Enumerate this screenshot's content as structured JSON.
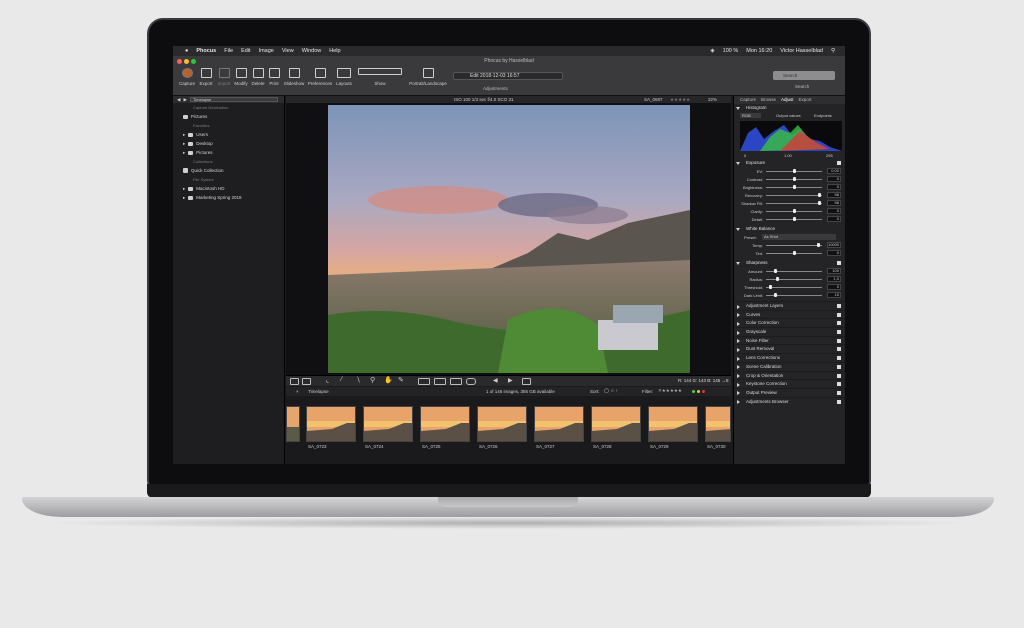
{
  "menubar": {
    "app": "Phocus",
    "items": [
      "File",
      "Edit",
      "Image",
      "View",
      "Window",
      "Help"
    ],
    "battery": "100 %",
    "clock": "Mon 16:20",
    "user": "Victor Hasselblad"
  },
  "window": {
    "title": "Phocus by Hasselblad",
    "edit_value": "Edit 2018-12-03 16:57",
    "adjustments_label": "Adjustments",
    "search_placeholder": "Search",
    "search_label": "Search",
    "show_label": "Show",
    "orientation_label": "Portrait/Landscape"
  },
  "toolbar": [
    "Capture",
    "Export",
    "Import",
    "Modify",
    "Delete",
    "Print",
    "Slideshow",
    "Preferences",
    "Layouts"
  ],
  "left_panel": {
    "dropdown": "Timelapse",
    "capture_destination": "Capture Destination",
    "pictures": "Pictures",
    "favorites": "Favorites",
    "users": "Users",
    "desktop": "Desktop",
    "pictures2": "Pictures",
    "collections": "Collections",
    "quick_collection": "Quick Collection",
    "file_system": "File System",
    "macintosh_hd": "Macintosh HD",
    "marketing": "Marketing Spring 2018"
  },
  "info_bar": {
    "exif": "ISO 100  1/3 sec  f/4.0  SCO 31",
    "filename": "SA_0687",
    "zoom": "32%"
  },
  "rgb_readout": "R: 144  G: 143  B: 145  →8",
  "filmstrip": {
    "folder": "Timelapse",
    "count": "1 of 146 images, 355 GB available",
    "sort_label": "Sort:",
    "filter_label": "Filter:",
    "thumbs": [
      "SA_0723",
      "SA_0724",
      "SA_0725",
      "SA_0726",
      "SA_0727",
      "SA_0728",
      "SA_0729",
      "SA_0730"
    ]
  },
  "right_panel": {
    "tabs": [
      "Capture",
      "Browse",
      "Adjust",
      "Export"
    ],
    "histogram_label": "Histogram",
    "histogram_channel": "RGB",
    "output_values": "Output values",
    "endpoints": "Endpoints",
    "histo_values": [
      "0",
      "1,00",
      "255"
    ],
    "exposure_label": "Exposure",
    "exposure_sliders": [
      {
        "label": "EV:",
        "value": "0,00",
        "pct": 0.5
      },
      {
        "label": "Contrast:",
        "value": "0",
        "pct": 0.5
      },
      {
        "label": "Brightness:",
        "value": "0",
        "pct": 0.5
      },
      {
        "label": "Recovery:",
        "value": "96",
        "pct": 0.96
      },
      {
        "label": "Shadow Fill:",
        "value": "96",
        "pct": 0.96
      },
      {
        "label": "Clarity:",
        "value": "0",
        "pct": 0.5
      },
      {
        "label": "Detail:",
        "value": "0",
        "pct": 0.5
      }
    ],
    "wb_label": "White Balance",
    "wb_preset_label": "Preset:",
    "wb_preset_value": "As Shot",
    "wb_sliders": [
      {
        "label": "Temp:",
        "value": "10000",
        "pct": 0.95
      },
      {
        "label": "Tint:",
        "value": "0",
        "pct": 0.5
      }
    ],
    "sharpness_label": "Sharpness",
    "sharpness_sliders": [
      {
        "label": "Amount:",
        "value": "100",
        "pct": 0.15
      },
      {
        "label": "Radius:",
        "value": "1,0",
        "pct": 0.18
      },
      {
        "label": "Threshold:",
        "value": "0",
        "pct": 0.05
      },
      {
        "label": "Dark Limit:",
        "value": "15",
        "pct": 0.15
      }
    ],
    "collapsed": [
      "Adjustment Layers",
      "Curves",
      "Color Correction",
      "Grayscale",
      "Noise Filter",
      "Dust Removal",
      "Lens Corrections",
      "Scene Calibration",
      "Crop & Orientation",
      "Keystone Correction",
      "Output Preview",
      "Adjustments Browser"
    ]
  }
}
